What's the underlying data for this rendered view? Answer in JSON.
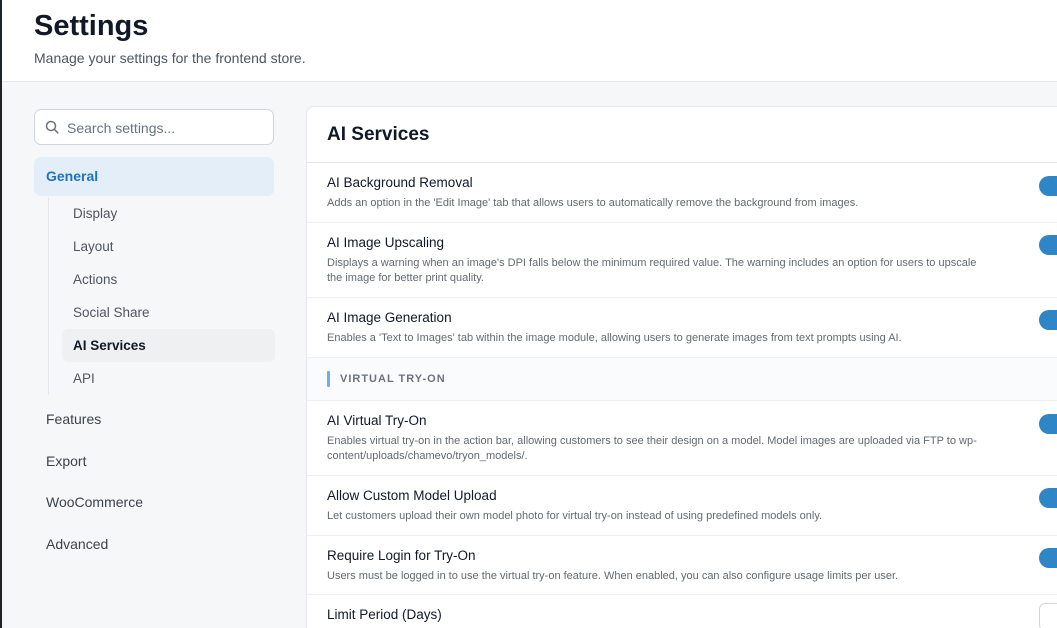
{
  "header": {
    "title": "Settings",
    "subtitle": "Manage your settings for the frontend store."
  },
  "search": {
    "placeholder": "Search settings..."
  },
  "sidebar": {
    "general": "General",
    "sub_items": [
      "Display",
      "Layout",
      "Actions",
      "Social Share",
      "AI Services",
      "API"
    ],
    "active_sub_item": "AI Services",
    "top_items": [
      "Features",
      "Export",
      "WooCommerce",
      "Advanced"
    ]
  },
  "panel": {
    "title": "AI Services",
    "settings": [
      {
        "title": "AI Background Removal",
        "description": "Adds an option in the 'Edit Image' tab that allows users to automatically remove the background from images.",
        "enabled": true
      },
      {
        "title": "AI Image Upscaling",
        "description": "Displays a warning when an image's DPI falls below the minimum required value. The warning includes an option for users to upscale the image for better print quality.",
        "enabled": true
      },
      {
        "title": "AI Image Generation",
        "description": "Enables a 'Text to Images' tab within the image module, allowing users to generate images from text prompts using AI.",
        "enabled": true
      }
    ],
    "section_label": "VIRTUAL TRY-ON",
    "tryon_settings": [
      {
        "title": "AI Virtual Try-On",
        "description": "Enables virtual try-on in the action bar, allowing customers to see their design on a model. Model images are uploaded via FTP to wp-content/uploads/chamevo/tryon_models/.",
        "enabled": true
      },
      {
        "title": "Allow Custom Model Upload",
        "description": "Let customers upload their own model photo for virtual try-on instead of using predefined models only.",
        "enabled": true
      },
      {
        "title": "Require Login for Try-On",
        "description": "Users must be logged in to use the virtual try-on feature. When enabled, you can also configure usage limits per user.",
        "enabled": true
      }
    ],
    "limit_period_label": "Limit Period (Days)"
  },
  "colors": {
    "accent": "#2f86c7",
    "active_nav_bg": "#e3eef8",
    "active_nav_text": "#1e73be"
  }
}
